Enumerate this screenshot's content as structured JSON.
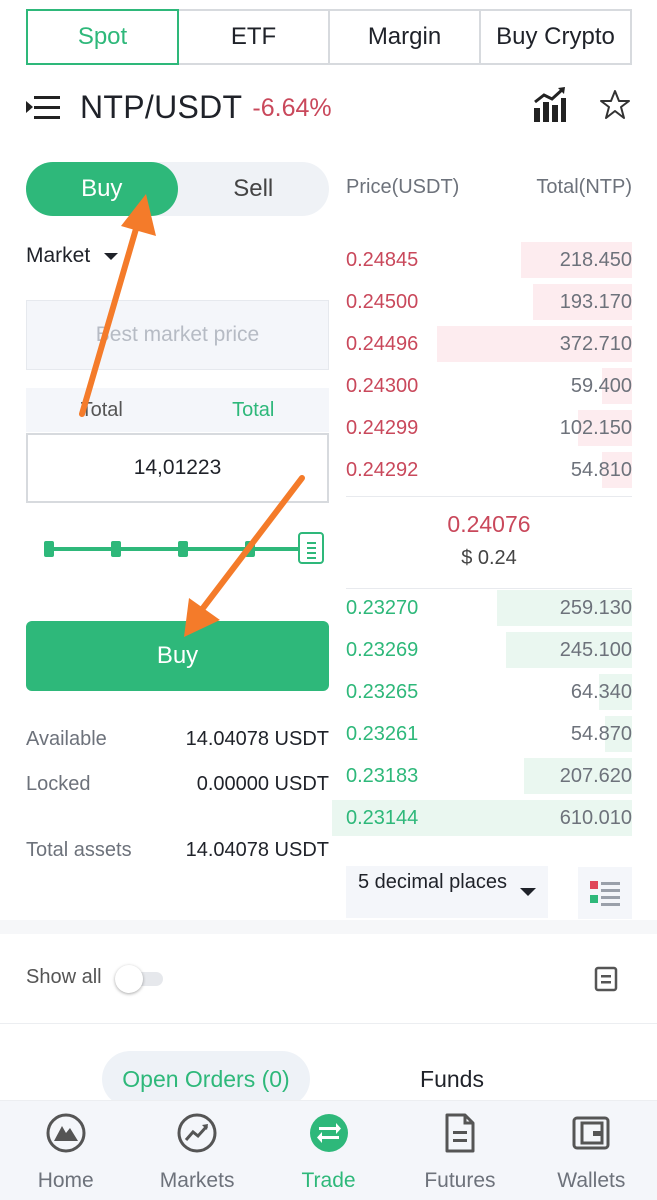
{
  "top_tabs": [
    {
      "label": "Spot",
      "active": true
    },
    {
      "label": "ETF",
      "active": false
    },
    {
      "label": "Margin",
      "active": false
    },
    {
      "label": "Buy Crypto",
      "active": false
    }
  ],
  "pair": {
    "name": "NTP/USDT",
    "change": "-6.64%"
  },
  "trade_side": {
    "buy": "Buy",
    "sell": "Sell",
    "active": "Buy"
  },
  "order_type": "Market",
  "market_price_placeholder": "Best market price",
  "total_tabs": [
    "Total",
    "Total"
  ],
  "amount_value": "14,01223",
  "slider": {
    "level_percent": 100
  },
  "buy_button_label": "Buy",
  "balances": [
    {
      "label": "Available",
      "value": "14.04078 USDT"
    },
    {
      "label": "Locked",
      "value": "0.00000 USDT"
    },
    {
      "label": "Total assets",
      "value": "14.04078 USDT"
    }
  ],
  "orderbook": {
    "price_header": "Price(USDT)",
    "total_header": "Total(NTP)",
    "asks": [
      {
        "price": "0.24845",
        "total": "218.450",
        "depth": 0.37
      },
      {
        "price": "0.24500",
        "total": "193.170",
        "depth": 0.33
      },
      {
        "price": "0.24496",
        "total": "372.710",
        "depth": 0.65
      },
      {
        "price": "0.24300",
        "total": "59.400",
        "depth": 0.1
      },
      {
        "price": "0.24299",
        "total": "102.150",
        "depth": 0.18
      },
      {
        "price": "0.24292",
        "total": "54.810",
        "depth": 0.1
      }
    ],
    "last_price": "0.24076",
    "last_price_usd": "$ 0.24",
    "bids": [
      {
        "price": "0.23270",
        "total": "259.130",
        "depth": 0.45
      },
      {
        "price": "0.23269",
        "total": "245.100",
        "depth": 0.42
      },
      {
        "price": "0.23265",
        "total": "64.340",
        "depth": 0.11
      },
      {
        "price": "0.23261",
        "total": "54.870",
        "depth": 0.09
      },
      {
        "price": "0.23183",
        "total": "207.620",
        "depth": 0.36
      },
      {
        "price": "0.23144",
        "total": "610.010",
        "depth": 1.0
      }
    ],
    "decimal_select": "5 decimal places"
  },
  "show_all_label": "Show all",
  "order_tabs": {
    "open_orders": "Open Orders (0)",
    "funds": "Funds"
  },
  "bottom_nav": [
    {
      "label": "Home",
      "icon": "home-icon",
      "active": false
    },
    {
      "label": "Markets",
      "icon": "markets-icon",
      "active": false
    },
    {
      "label": "Trade",
      "icon": "trade-icon",
      "active": true
    },
    {
      "label": "Futures",
      "icon": "futures-icon",
      "active": false
    },
    {
      "label": "Wallets",
      "icon": "wallets-icon",
      "active": false
    }
  ],
  "colors": {
    "accent_green": "#2eb87a",
    "ask_red": "#c9485b",
    "annotation_orange": "#f47b2a"
  }
}
